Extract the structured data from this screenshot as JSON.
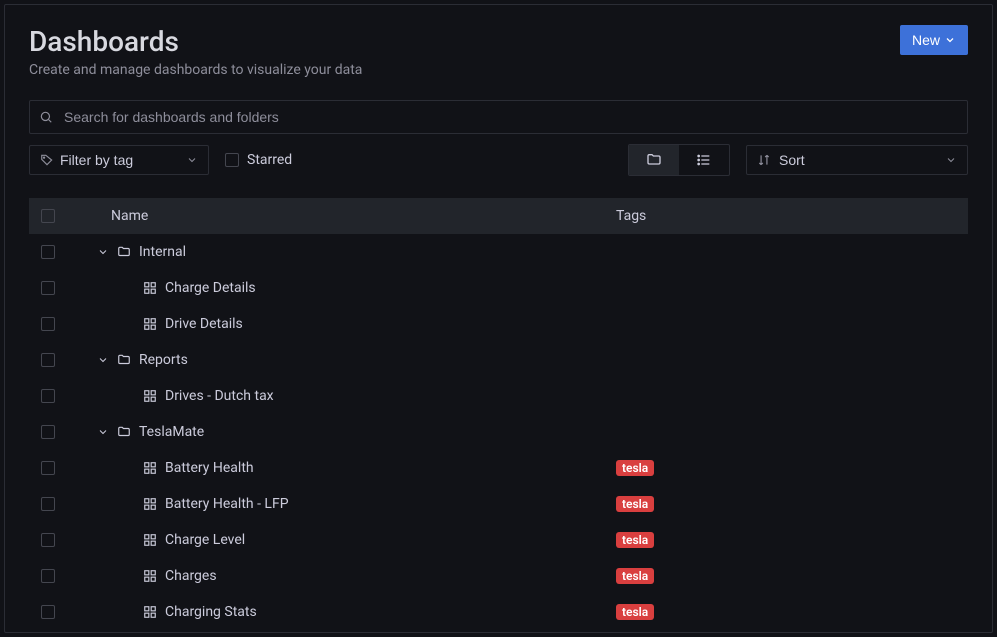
{
  "header": {
    "title": "Dashboards",
    "subtitle": "Create and manage dashboards to visualize your data",
    "new_button_label": "New"
  },
  "search": {
    "placeholder": "Search for dashboards and folders"
  },
  "filters": {
    "tag_label": "Filter by tag",
    "starred_label": "Starred",
    "sort_label": "Sort"
  },
  "columns": {
    "name": "Name",
    "tags": "Tags"
  },
  "rows": [
    {
      "type": "folder",
      "label": "Internal"
    },
    {
      "type": "dashboard",
      "label": "Charge Details"
    },
    {
      "type": "dashboard",
      "label": "Drive Details"
    },
    {
      "type": "folder",
      "label": "Reports"
    },
    {
      "type": "dashboard",
      "label": "Drives - Dutch tax"
    },
    {
      "type": "folder",
      "label": "TeslaMate"
    },
    {
      "type": "dashboard",
      "label": "Battery Health",
      "tag": "tesla"
    },
    {
      "type": "dashboard",
      "label": "Battery Health - LFP",
      "tag": "tesla"
    },
    {
      "type": "dashboard",
      "label": "Charge Level",
      "tag": "tesla"
    },
    {
      "type": "dashboard",
      "label": "Charges",
      "tag": "tesla"
    },
    {
      "type": "dashboard",
      "label": "Charging Stats",
      "tag": "tesla"
    }
  ],
  "colors": {
    "accent": "#3d71d9",
    "tag": "#d93f3f"
  }
}
